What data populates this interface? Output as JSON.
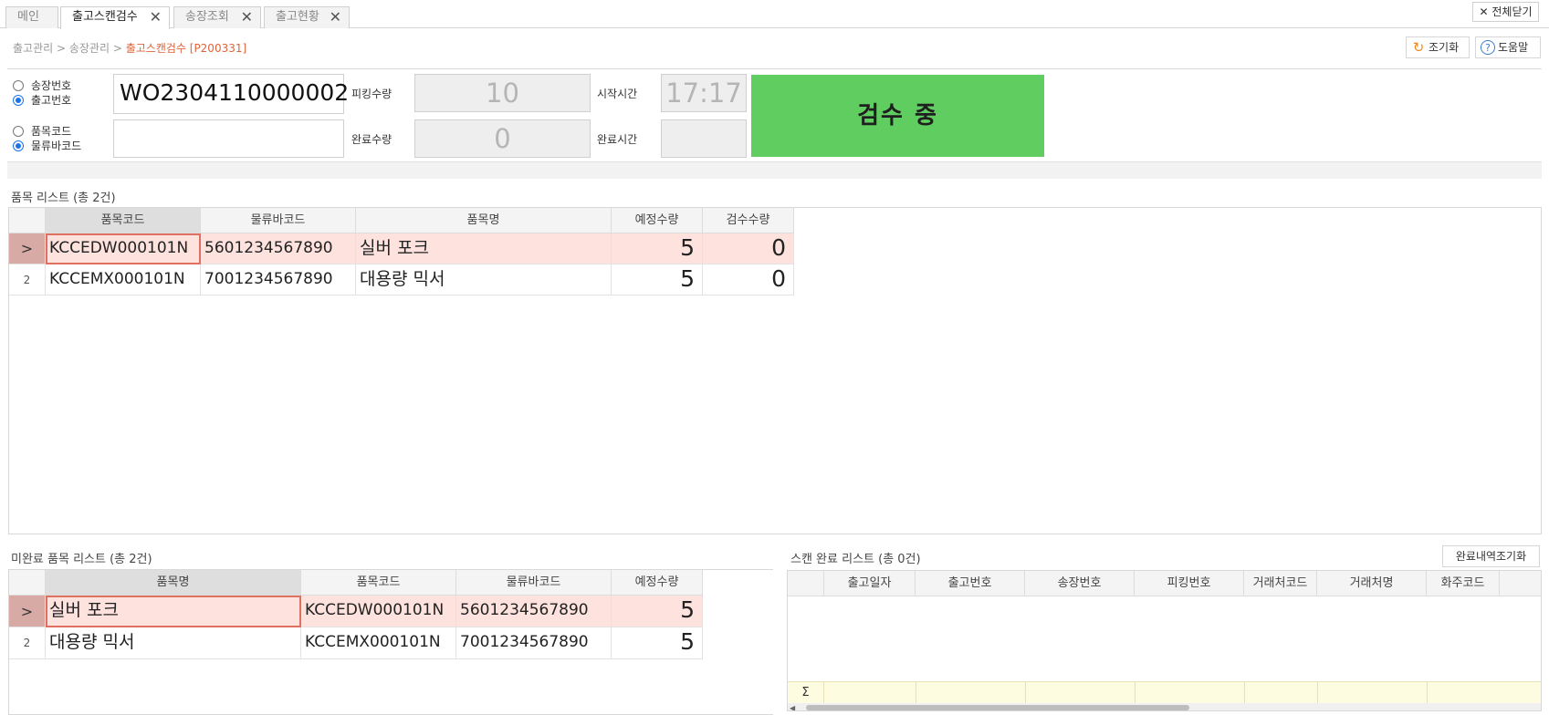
{
  "tabs": [
    {
      "label": "메인",
      "closable": false
    },
    {
      "label": "출고스캔검수",
      "closable": true,
      "active": true
    },
    {
      "label": "송장조회",
      "closable": true
    },
    {
      "label": "출고현황",
      "closable": true
    }
  ],
  "close_all_label": "전체닫기",
  "breadcrumb": {
    "path": "출고관리 > 송장관리 > ",
    "current": "출고스캔검수 [P200331]"
  },
  "toolbar": {
    "reset_label": "조기화",
    "help_label": "도움말"
  },
  "scan": {
    "radio_group1": [
      {
        "label": "송장번호",
        "checked": false
      },
      {
        "label": "출고번호",
        "checked": true
      }
    ],
    "radio_group2": [
      {
        "label": "품목코드",
        "checked": false
      },
      {
        "label": "물류바코드",
        "checked": true
      }
    ],
    "scan_value": "WO2304110000002",
    "barcode_value": "",
    "picking_qty_label": "피킹수량",
    "picking_qty": "10",
    "done_qty_label": "완료수량",
    "done_qty": "0",
    "start_time_label": "시작시간",
    "start_time": "17:17",
    "end_time_label": "완료시간",
    "end_time": "",
    "status": "검수 중",
    "status_color": "#5fcd5f"
  },
  "item_list": {
    "title": "품목 리스트 (총 2건)",
    "columns": [
      "품목코드",
      "물류바코드",
      "품목명",
      "예정수량",
      "검수수량"
    ],
    "rows": [
      {
        "row": ">",
        "code": "KCCEDW000101N",
        "barcode": "5601234567890",
        "name": "실버 포크",
        "planned": "5",
        "inspected": "0"
      },
      {
        "row": "2",
        "code": "KCCEMX000101N",
        "barcode": "7001234567890",
        "name": "대용량 믹서",
        "planned": "5",
        "inspected": "0"
      }
    ]
  },
  "incomplete_list": {
    "title": "미완료 품목 리스트 (총 2건)",
    "columns": [
      "품목명",
      "품목코드",
      "물류바코드",
      "예정수량"
    ],
    "rows": [
      {
        "row": ">",
        "name": "실버 포크",
        "code": "KCCEDW000101N",
        "barcode": "5601234567890",
        "planned": "5"
      },
      {
        "row": "2",
        "name": "대용량 믹서",
        "code": "KCCEMX000101N",
        "barcode": "7001234567890",
        "planned": "5"
      }
    ]
  },
  "scan_done_list": {
    "title": "스캔 완료 리스트 (총 0건)",
    "reset_button": "완료내역조기화",
    "columns": [
      "출고일자",
      "출고번호",
      "송장번호",
      "피킹번호",
      "거래처코드",
      "거래처명",
      "화주코드"
    ],
    "sum_symbol": "Σ"
  }
}
